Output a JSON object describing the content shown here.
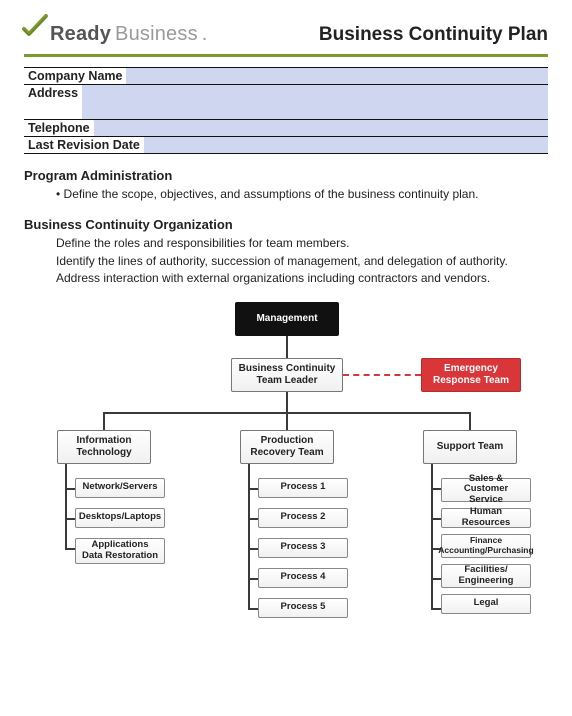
{
  "header": {
    "logo_ready": "Ready",
    "logo_business": "Business",
    "logo_dot": ".",
    "title": "Business Continuity Plan"
  },
  "form": {
    "company_label": "Company Name",
    "address_label": "Address",
    "telephone_label": "Telephone",
    "revision_label": "Last Revision Date",
    "company_value": "",
    "address_value": "",
    "telephone_value": "",
    "revision_value": ""
  },
  "section1": {
    "heading": "Program Administration",
    "items": [
      "Define the scope, objectives, and assumptions of the business continuity plan."
    ]
  },
  "section2": {
    "heading": "Business Continuity Organization",
    "items": [
      "Define the roles and responsibilities for team members.",
      "Identify the lines of authority, succession of management, and delegation of authority.",
      "Address interaction with external organizations including contractors and vendors."
    ]
  },
  "org": {
    "management": "Management",
    "bcl": "Business Continuity Team Leader",
    "ert": "Emergency Response Team",
    "col1_head": "Information Technology",
    "col2_head": "Production Recovery Team",
    "col3_head": "Support Team",
    "col1": [
      "Network/Servers",
      "Desktops/Laptops",
      "Applications Data Restoration"
    ],
    "col2": [
      "Process 1",
      "Process 2",
      "Process 3",
      "Process 4",
      "Process 5"
    ],
    "col3": [
      "Sales & Customer Service",
      "Human Resources",
      "Finance Accounting/Purchasing",
      "Facilities/ Engineering",
      "Legal"
    ]
  },
  "colors": {
    "accent_green": "#7c9a2f",
    "field_blue": "#cfd6ef",
    "node_red": "#d9363a"
  }
}
